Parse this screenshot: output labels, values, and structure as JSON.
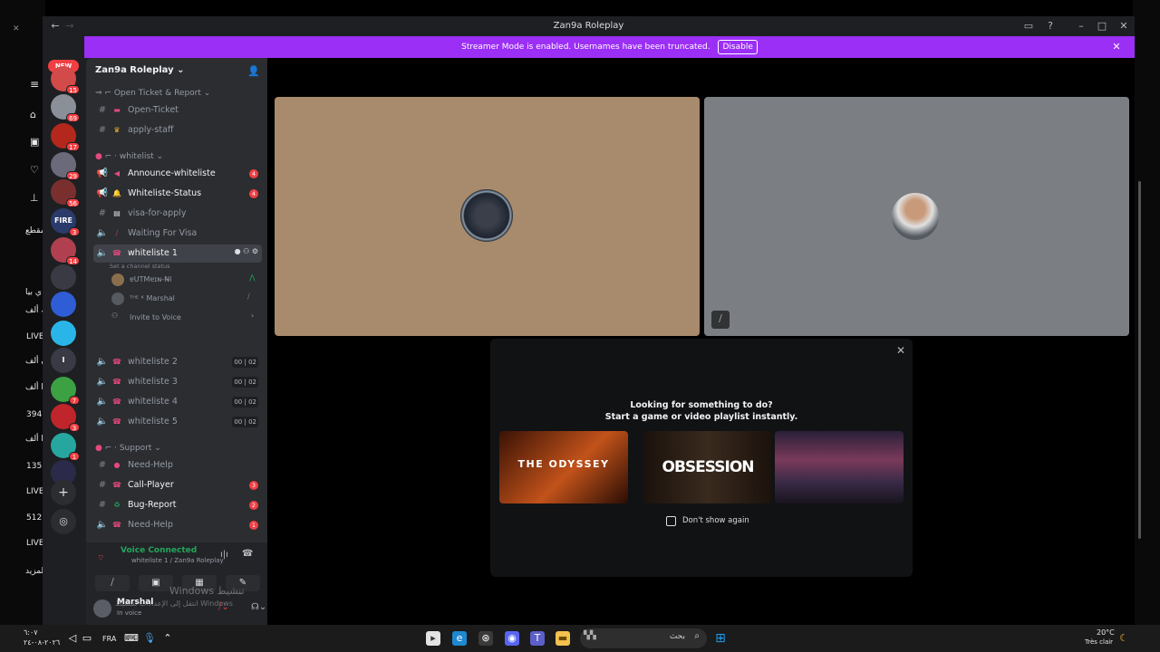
{
  "window": {
    "title": "Zan9a Roleplay"
  },
  "banner": {
    "text": "Streamer Mode is enabled. Usernames have been truncated.",
    "button": "Disable"
  },
  "rail": {
    "new_label": "NEW",
    "servers": [
      {
        "badge": "15",
        "color": "#d24a4a"
      },
      {
        "badge": "69",
        "color": "#8a8f98"
      },
      {
        "badge": "17",
        "color": "#b3271d"
      },
      {
        "badge": "29",
        "color": "#6a6a7a"
      },
      {
        "badge": "56",
        "color": "#7a2f2f"
      },
      {
        "badge": "3",
        "color": "#2a3a6a",
        "label": "FIRE"
      },
      {
        "badge": "14",
        "color": "#b04050"
      },
      {
        "badge": "",
        "color": "#3a3a44"
      },
      {
        "badge": "",
        "color": "#2f5dd6"
      },
      {
        "badge": "",
        "color": "#2ab5e8"
      },
      {
        "badge": "",
        "color": "#3a3a44",
        "label": "I"
      },
      {
        "badge": "7",
        "color": "#3ca142"
      },
      {
        "badge": "3",
        "color": "#c0252b"
      },
      {
        "badge": "1",
        "color": "#27a6a0"
      },
      {
        "badge": "",
        "color": "#2c2a4a"
      }
    ]
  },
  "sidebar": {
    "server_name": "Zan9a Roleplay",
    "categories": {
      "ticket": "Open Ticket & Report",
      "whitelist": "whitelist",
      "support": "Support"
    },
    "channels": {
      "open_ticket": "Open-Ticket",
      "apply_staff": "apply-staff",
      "announce": "Announce-whiteliste",
      "announce_badge": "4",
      "status": "Whiteliste-Status",
      "status_badge": "4",
      "visa": "visa-for-apply",
      "waiting": "Waiting For Visa",
      "wl1": "whiteliste 1",
      "wl1_status": "Set a channel status",
      "wl2": "whiteliste 2",
      "wl3": "whiteliste 3",
      "wl4": "whiteliste 4",
      "wl5": "whiteliste 5",
      "count_a": "00",
      "count_b": "02",
      "need_help": "Need-Help",
      "call_player": "Call-Player",
      "call_badge": "3",
      "bug_report": "Bug-Report",
      "bug_badge": "2",
      "need_help2": "Need-Help",
      "need_help2_badge": "1"
    },
    "voice_users": {
      "u1": "ɐUTMɐɪɴ-N̶l",
      "u2": "ᵀᴴᴱ ᴷ Marshal",
      "invite": "Invite to Voice"
    }
  },
  "voice_panel": {
    "status": "Voice Connected",
    "channel": "whiteliste 1 / Zan9a Roleplay"
  },
  "user_panel": {
    "name": "Marshal",
    "status": "In voice"
  },
  "watermark": {
    "line1": "Windows تنشيط",
    "line2": "انتقل إلى الإعدادات لتنشيط Windows"
  },
  "activity": {
    "line1": "Looking for something to do?",
    "line2": "Start a game or video playlist instantly.",
    "cards": [
      "THE ODYSSEY",
      "OBSESSION",
      ""
    ],
    "checkbox": "Don't show again"
  },
  "background_page": {
    "left_texts": [
      "مقطع",
      "ي بيا",
      "ك ألف",
      "LIVE",
      "ن ألف",
      "ا ألف",
      "394",
      "ا ألف",
      "135",
      "LIVE",
      "512",
      "LIVE",
      "المزيد"
    ]
  },
  "taskbar": {
    "lang": "FRA",
    "search": "بحث",
    "weather_temp": "20°C",
    "weather_desc": "Très clair",
    "time": "٦:٠٧",
    "date": "٢٠٢٦-٠٨-٢٤"
  },
  "colors": {
    "accent_banner": "#9b2ff5",
    "voice_green": "#23a55a",
    "badge_red": "#f23f43"
  }
}
